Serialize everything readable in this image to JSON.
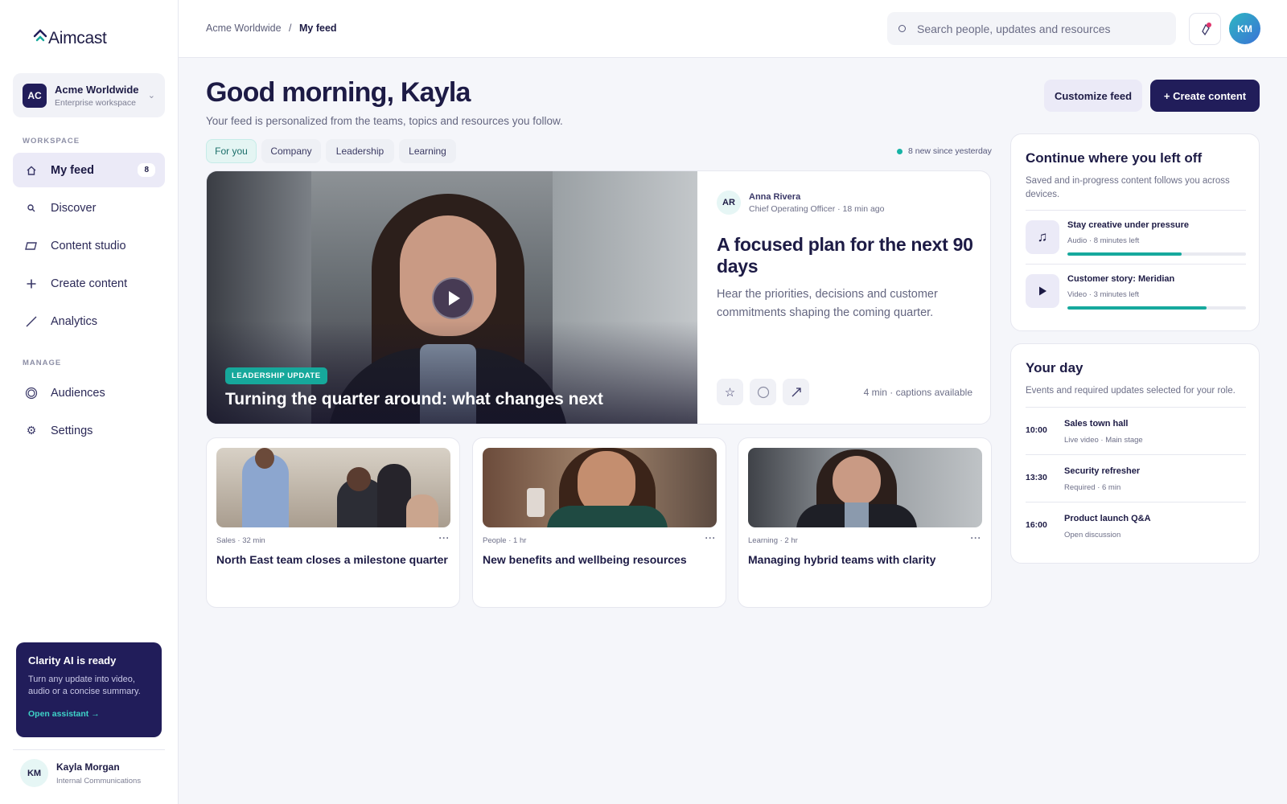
{
  "brand": {
    "name": "Aimcast"
  },
  "workspace": {
    "initials": "AC",
    "name": "Acme Worldwide",
    "type": "Enterprise workspace"
  },
  "sidebar": {
    "section_workspace": "WORKSPACE",
    "section_manage": "MANAGE",
    "items": [
      {
        "label": "My feed",
        "icon": "home-icon",
        "count": "8",
        "active": true
      },
      {
        "label": "Discover",
        "icon": "search-icon"
      },
      {
        "label": "Content studio",
        "icon": "studio-icon"
      },
      {
        "label": "Create content",
        "icon": "plus-icon"
      },
      {
        "label": "Analytics",
        "icon": "trend-icon"
      },
      {
        "label": "Audiences",
        "icon": "audience-icon"
      },
      {
        "label": "Settings",
        "icon": "gear-icon"
      }
    ],
    "ai": {
      "title": "Clarity AI is ready",
      "body": "Turn any update into video, audio or a concise summary.",
      "link": "Open assistant →"
    },
    "user": {
      "initials": "KM",
      "name": "Kayla Morgan",
      "role": "Internal Communications"
    }
  },
  "topbar": {
    "breadcrumb_root": "Acme Worldwide",
    "breadcrumb_sep": "/",
    "breadcrumb_current": "My feed",
    "search_placeholder": "Search people, updates and resources",
    "avatar_initials": "KM"
  },
  "header": {
    "greeting": "Good morning, Kayla",
    "subtitle": "Your feed is personalized from the teams, topics and resources you follow.",
    "customize_label": "Customize feed",
    "create_label": "+ Create content"
  },
  "tabs": [
    "For you",
    "Company",
    "Leadership",
    "Learning"
  ],
  "new_since": "8 new since yesterday",
  "hero": {
    "tag": "LEADERSHIP UPDATE",
    "video_title": "Turning the quarter around: what changes next",
    "author_initials": "AR",
    "author_name": "Anna Rivera",
    "author_meta": "Chief Operating Officer · 18 min ago",
    "heading": "A focused plan for the next 90 days",
    "description": "Hear the priorities, decisions and customer commitments shaping the coming quarter.",
    "meta": "4 min · captions available"
  },
  "cards": [
    {
      "meta": "Sales · 32 min",
      "title": "North East team closes a milestone quarter",
      "more": "···"
    },
    {
      "meta": "People · 1 hr",
      "title": "New benefits and wellbeing resources",
      "more": "···"
    },
    {
      "meta": "Learning · 2 hr",
      "title": "Managing hybrid teams with clarity",
      "more": "···"
    }
  ],
  "continue": {
    "title": "Continue where you left off",
    "subtitle": "Saved and in-progress content follows you across devices.",
    "items": [
      {
        "title": "Stay creative under pressure",
        "meta": "Audio · 8 minutes left",
        "icon": "music-icon",
        "progress": 0.64
      },
      {
        "title": "Customer story: Meridian",
        "meta": "Video · 3 minutes left",
        "icon": "play-icon",
        "progress": 0.78
      }
    ]
  },
  "day": {
    "title": "Your day",
    "subtitle": "Events and required updates selected for your role.",
    "events": [
      {
        "time": "10:00",
        "title": "Sales town hall",
        "meta": "Live video · Main stage"
      },
      {
        "time": "13:30",
        "title": "Security refresher",
        "meta": "Required · 6 min"
      },
      {
        "time": "16:00",
        "title": "Product launch Q&A",
        "meta": "Open discussion"
      }
    ]
  },
  "colors": {
    "navy": "#211d5a",
    "teal": "#17a99d",
    "accent_pink": "#e0356c"
  }
}
